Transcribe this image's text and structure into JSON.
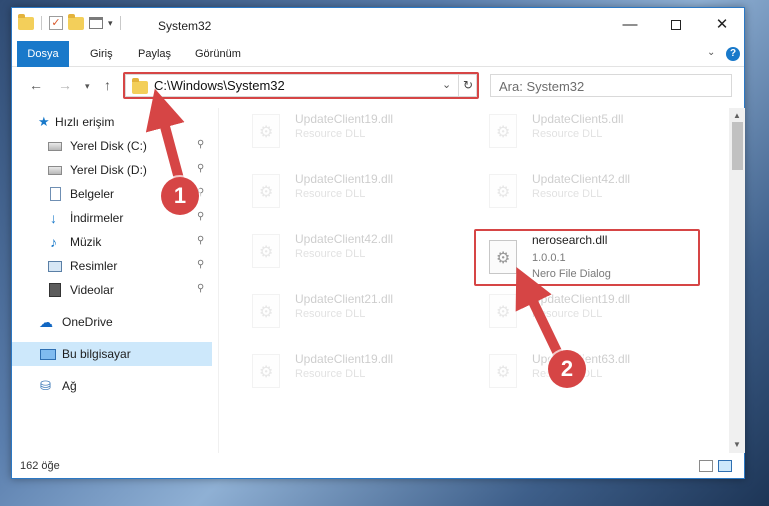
{
  "window": {
    "title": "System32",
    "controls": {
      "minimize": "—",
      "close": "✕"
    }
  },
  "ribbon": {
    "tabs": [
      "Dosya",
      "Giriş",
      "Paylaş",
      "Görünüm"
    ],
    "expand_glyph": "⌄",
    "help_glyph": "?"
  },
  "address": {
    "path": "C:\\Windows\\System32",
    "refresh_glyph": "↻",
    "dropdown_glyph": "⌄"
  },
  "search": {
    "placeholder": "Ara: System32"
  },
  "nav": {
    "back": "←",
    "forward": "→",
    "recent": "▾",
    "up": "↑"
  },
  "sidebar": {
    "quick_access": "Hızlı erişim",
    "items": [
      {
        "label": "Yerel Disk (C:)",
        "icon": "drive-icon",
        "pinned": true
      },
      {
        "label": "Yerel Disk (D:)",
        "icon": "drive-icon",
        "pinned": true
      },
      {
        "label": "Belgeler",
        "icon": "documents-icon",
        "pinned": true
      },
      {
        "label": "İndirmeler",
        "icon": "downloads-icon",
        "pinned": true
      },
      {
        "label": "Müzik",
        "icon": "music-icon",
        "pinned": true
      },
      {
        "label": "Resimler",
        "icon": "pictures-icon",
        "pinned": true
      },
      {
        "label": "Videolar",
        "icon": "videos-icon",
        "pinned": true
      }
    ],
    "onedrive": "OneDrive",
    "this_pc": "Bu bilgisayar",
    "network": "Ağ",
    "pin_glyph": "📌"
  },
  "files": [
    {
      "name": "UpdateClient19.dll",
      "desc": "Resource DLL"
    },
    {
      "name": "UpdateClient5.dll",
      "desc": "Resource DLL"
    },
    {
      "name": "UpdateClient19.dll",
      "desc": "Resource DLL"
    },
    {
      "name": "UpdateClient42.dll",
      "desc": "Resource DLL"
    },
    {
      "name": "UpdateClient42.dll",
      "desc": "Resource DLL"
    },
    {
      "name": "nerosearch.dll",
      "version": "1.0.0.1",
      "desc": "Nero File Dialog"
    },
    {
      "name": "UpdateClient21.dll",
      "desc": "Resource DLL"
    },
    {
      "name": "UpdateClient19.dll",
      "desc": "Resource DLL"
    },
    {
      "name": "UpdateClient19.dll",
      "desc": "Resource DLL"
    },
    {
      "name": "UpdateClient63.dll",
      "desc": "Resource DLL"
    }
  ],
  "status": {
    "item_count": "162 öğe"
  },
  "annotations": {
    "step1": "1",
    "step2": "2",
    "color": "#d64545"
  }
}
